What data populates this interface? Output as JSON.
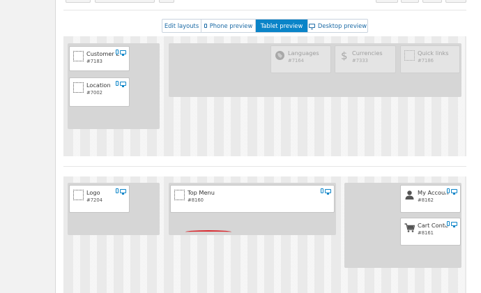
{
  "view_tabs": [
    {
      "label": "Edit layouts",
      "icon": "",
      "active": false
    },
    {
      "label": "Phone preview",
      "icon": "phone-icon",
      "active": false
    },
    {
      "label": "Tablet preview",
      "icon": "",
      "active": true
    },
    {
      "label": "Desktop preview",
      "icon": "desktop-icon",
      "active": false
    }
  ],
  "header_row": {
    "left_column": [
      {
        "name": "Customer L",
        "id": "#7183",
        "icon": "placeholder"
      },
      {
        "name": "Location",
        "id": "#7002",
        "icon": "placeholder"
      }
    ],
    "right_area": [
      {
        "name": "Languages",
        "id": "#7164",
        "icon": "globe-icon"
      },
      {
        "name": "Currencies",
        "id": "#7333",
        "icon": "dollar-icon"
      },
      {
        "name": "Quick links",
        "id": "#7186",
        "icon": "placeholder"
      }
    ]
  },
  "nav_row": {
    "left_column": [
      {
        "name": "Logo",
        "id": "#7204",
        "icon": "placeholder"
      }
    ],
    "center_column": [
      {
        "name": "Top Menu",
        "id": "#8160",
        "icon": "placeholder"
      }
    ],
    "right_column": [
      {
        "name": "My Accoun",
        "id": "#8162",
        "icon": "user-icon"
      },
      {
        "name": "Cart Conte",
        "id": "#8161",
        "icon": "cart-icon"
      }
    ]
  },
  "colors": {
    "accent": "#0a84c8",
    "annotation": "#d9262c",
    "column_bg": "#d6d6d6"
  }
}
